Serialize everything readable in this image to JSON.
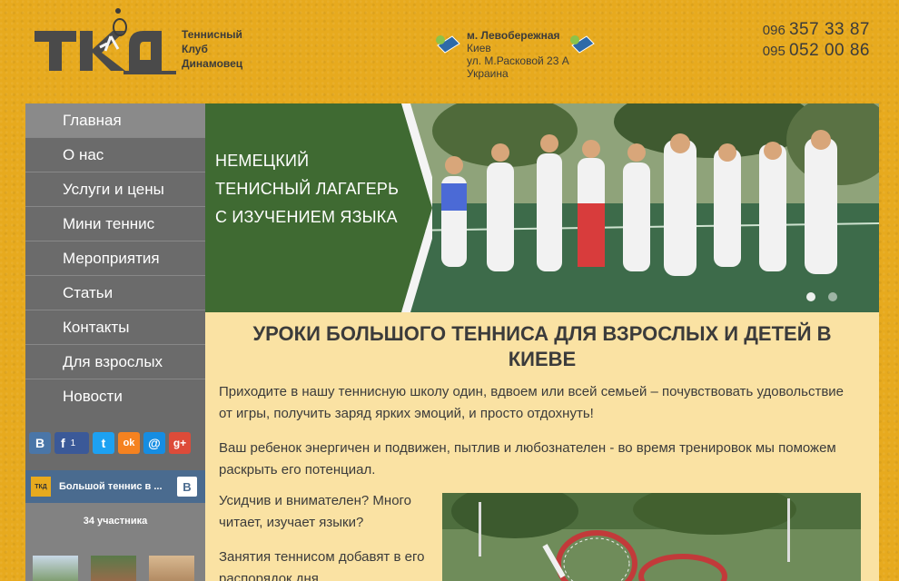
{
  "header": {
    "logo_lines": [
      "Теннисный",
      "Клуб",
      "Динамовец"
    ],
    "address": {
      "metro": "м. Левобережная",
      "city": "Киев",
      "street": "ул. М.Расковой 23 А",
      "country": "Украина"
    },
    "phones": [
      {
        "code": "096",
        "number": "357 33 87"
      },
      {
        "code": "095",
        "number": "052 00 86"
      }
    ]
  },
  "sidebar": {
    "menu": [
      {
        "label": "Главная",
        "active": true
      },
      {
        "label": "О нас"
      },
      {
        "label": "Услуги и цены"
      },
      {
        "label": "Мини теннис"
      },
      {
        "label": "Мероприятия"
      },
      {
        "label": "Статьи"
      },
      {
        "label": "Контакты"
      },
      {
        "label": "Для взрослых"
      },
      {
        "label": "Новости"
      }
    ],
    "social": [
      {
        "name": "vk-icon",
        "glyph": "B",
        "color": "#4a76a8"
      },
      {
        "name": "facebook-icon",
        "glyph": "f",
        "color": "#3b5998",
        "count": "1"
      },
      {
        "name": "twitter-icon",
        "glyph": "t",
        "color": "#1da1f2"
      },
      {
        "name": "odnoklassniki-icon",
        "glyph": "ok",
        "color": "#f58220"
      },
      {
        "name": "mail-icon",
        "glyph": "@",
        "color": "#168de2"
      },
      {
        "name": "google-plus-icon",
        "glyph": "g+",
        "color": "#dd4b39"
      }
    ],
    "vk_widget": {
      "thumb": "ТКД",
      "title": "Большой теннис в ...",
      "logo": "B",
      "members": "34 участника"
    }
  },
  "banner": {
    "lines": [
      "НЕМЕЦКИЙ",
      "ТЕНИСНЫЙ ЛАГАГЕРЬ",
      "С ИЗУЧЕНИЕМ ЯЗЫКА"
    ]
  },
  "content": {
    "title": "УРОКИ БОЛЬШОГО ТЕННИСА ДЛЯ ВЗРОСЛЫХ И ДЕТЕЙ В КИЕВЕ",
    "p1": "Приходите в нашу теннисную школу один, вдвоем или всей семьей – почувствовать удовольствие от игры, получить заряд ярких эмоций, и просто отдохнуть!",
    "p2": "Ваш ребенок энергичен и подвижен, пытлив и любознателен - во время тренировок мы поможем раскрыть его потенциал.",
    "p3": "Усидчив и внимателен? Много читает, изучает языки?",
    "p4": "Занятия теннисом добавят в его распорядок дня"
  },
  "colors": {
    "background": "#e7aa1e",
    "sidebar": "#6b6b6b",
    "content_bg": "#fae2a3",
    "text": "#3b3b3b"
  }
}
